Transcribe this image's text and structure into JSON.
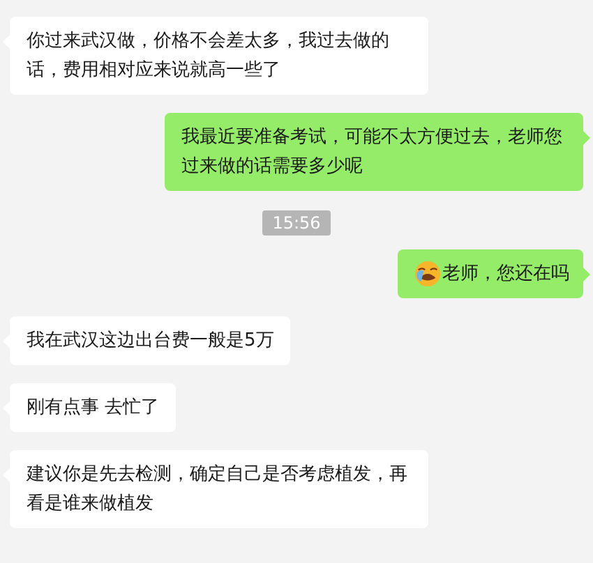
{
  "messages": [
    {
      "kind": "incoming",
      "text": "你过来武汉做，价格不会差太多，我过去做的话，费用相对应来说就高一些了"
    },
    {
      "kind": "outgoing",
      "text": "我最近要准备考试，可能不太方便过去，老师您过来做的话需要多少呢",
      "emoji": false
    },
    {
      "kind": "time",
      "text": "15:56"
    },
    {
      "kind": "outgoing",
      "text": "老师，您还在吗",
      "emoji": true
    },
    {
      "kind": "incoming",
      "text": "我在武汉这边出台费一般是5万"
    },
    {
      "kind": "incoming",
      "text": "刚有点事 去忙了"
    },
    {
      "kind": "incoming",
      "text": "建议你是先去检测，确定自己是否考虑植发，再看是谁来做植发"
    }
  ]
}
